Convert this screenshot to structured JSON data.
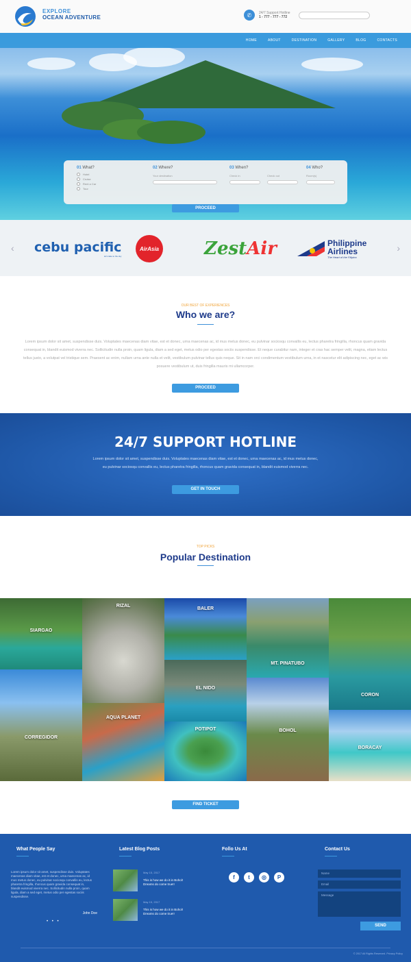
{
  "header": {
    "brand_top": "EXPLORE",
    "brand_bottom": "OCEAN ADVENTURE",
    "hotline_label": "24/7 Support Hotline",
    "hotline_number": "1 - 777 - 777 - 772"
  },
  "nav": {
    "items": [
      "HOME",
      "ABOUT",
      "DESTINATION",
      "GALLERY",
      "BLOG",
      "CONTACTS"
    ]
  },
  "search_panel": {
    "what_num": "01",
    "what_label": "What?",
    "where_num": "02",
    "where_label": "Where?",
    "when_num": "03",
    "when_label": "When?",
    "who_num": "04",
    "who_label": "Who?",
    "options": [
      "Hotel",
      "Cruise",
      "Rent a Car",
      "Tour"
    ],
    "where_sub": "Your destination",
    "checkin_sub": "Check in",
    "checkout_sub": "Check out",
    "guests_sub": "Room(s)",
    "proceed": "PROCEED"
  },
  "airlines": {
    "cebu_name": "cebu pacific",
    "cebu_tagline": "let's take to the sky",
    "airasia": "AirAsia",
    "zest_main": "Zest",
    "zest_accent": "Air",
    "pal_name_1": "Philippine",
    "pal_name_2": "Airlines",
    "pal_tagline": "The Heart of the Filipino"
  },
  "who": {
    "kicker": "OUR BEST OF EXPERIENCES",
    "title": "Who we are?",
    "body": "Lorem ipsum dolor sit amet, suspendisse duis. Voluptates maecenas diam vitae, est et donec, urna maecenas ac, id mus metus donec, eu pulvinar sociosqu convallis eu, lectus pharetra fringilla, rhoncus quam gravida consequat in, blandit euismod viverra nec. Sollicitudin nulla proin, quam ligula, diam a sed eget, metus odio per egestas sociis suspendisse. Et neque curabitur nam, integer et cras hac semper velit, magna, etiam lectus tellus justo, a volutpat vel tristique sem. Praesent ac enim, nullam urna ante nulla et velit, vestibulum pulvinar tellus quis neque. Sit in nam orci condimentum vestibulum urna, in et nascetur elit adipiscing nec, eget ac wis posuere vestibulum ut, duis fringilla mauris mi ullamcorper.",
    "button": "PROCEED"
  },
  "hotline_band": {
    "title": "24/7 SUPPORT HOTLINE",
    "body": "Lorem ipsum dolor sit amet, suspendisse duis. Voluptates maecenas diam vitae, est et donec, urna maecenas ac, id mus metus donec, eu pulvinar sociosqu convallis eu, lectus pharetra fringilla, rhoncus quam gravida consequat in, blandit euismod viverra nec.",
    "button": "GET IN TOUCH"
  },
  "popular": {
    "kicker": "TOP PICKS",
    "title": "Popular Destination",
    "destinations": [
      "SIARGAO",
      "RIZAL",
      "BALER",
      "MT. PINATUBO",
      "CORON",
      "CORREGIDOR",
      "AQUA PLANET",
      "EL NIDO",
      "POTIPOT",
      "BOHOL",
      "BORACAY"
    ],
    "button": "FIND TICKET"
  },
  "footer": {
    "people_head": "What People Say",
    "quote": "Lorem ipsum dolor sit amet, suspendisse duis. Voluptates maecenas diam vitae, est et donec, urna maecenas ac, id mus metus donec, eu pulvinar sociosqu convallis eu, lectus pharetra fringilla, rhoncus quam gravida consequat in, blandit euismod viverra nec. Sollicitudin nulla proin, quam ligula, diam a sed eget, metus odio per egestas sociis suspendisse.",
    "author": "John Doe",
    "blog_head": "Latest Blog Posts",
    "posts": [
      {
        "date": "May 15, 2017",
        "title": "This is how we do it in Bohol! Dreams do come true!!"
      },
      {
        "date": "May 15, 2017",
        "title": "This is how we do it in Bohol! Dreams do come true!!"
      }
    ],
    "follow_head": "Follo Us At",
    "social": [
      "f",
      "t",
      "◎",
      "P"
    ],
    "contact_head": "Contact Us",
    "name_ph": "Name",
    "email_ph": "Email",
    "message_ph": "Message",
    "send": "SEND",
    "copyright": "© 2017 All Rights Reserved. Privacy Policy"
  }
}
